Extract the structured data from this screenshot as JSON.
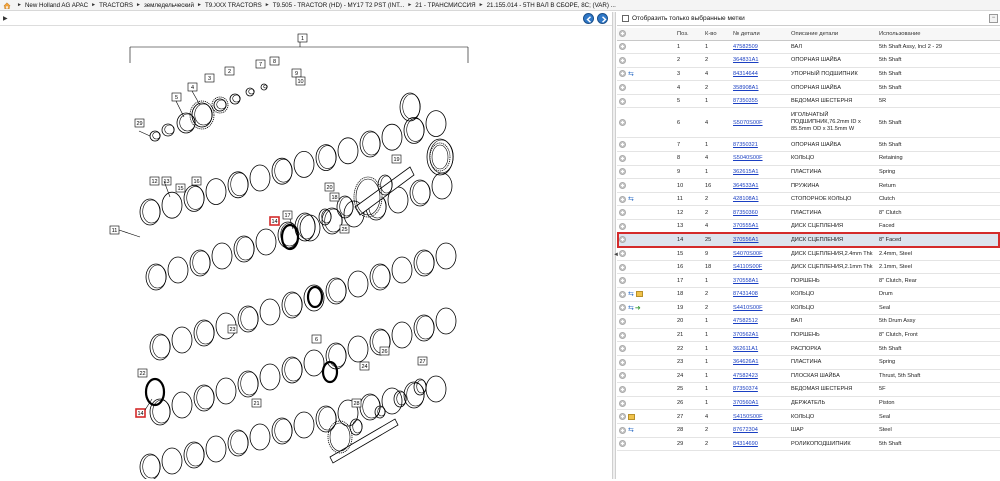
{
  "breadcrumb": [
    "New Holland AG APAC",
    "TRACTORS",
    "земледельческий",
    "T9.XXX TRACTORS",
    "T9.505 - TRACTOR (HD) - MY17 T2 PST (INT...",
    "21 - ТРАНСМИССИЯ",
    "21.155.014 - 5TH ВАЛ В СБОРЕ, 8C; (VAR) ..."
  ],
  "filter": {
    "label": "Отобразить только выбранные метки"
  },
  "table": {
    "columns": [
      "Поз.",
      "К-во",
      "№ детали",
      "Описание детали",
      "Использование"
    ],
    "rows": [
      {
        "pos": "1",
        "qty": "1",
        "part": "47582509",
        "desc": "ВАЛ",
        "use": "5th Shaft Assy, Incl 2 - 29",
        "icons": []
      },
      {
        "pos": "2",
        "qty": "2",
        "part": "364831A1",
        "desc": "ОПОРНАЯ ШАЙБА",
        "use": "5th Shaft",
        "icons": []
      },
      {
        "pos": "3",
        "qty": "4",
        "part": "84314644",
        "desc": "УПОРНЫЙ ПОДШИПНИК",
        "use": "5th Shaft",
        "icons": [
          "swap"
        ]
      },
      {
        "pos": "4",
        "qty": "2",
        "part": "358908A1",
        "desc": "ОПОРНАЯ ШАЙБА",
        "use": "5th Shaft",
        "icons": []
      },
      {
        "pos": "5",
        "qty": "1",
        "part": "87350355",
        "desc": "ВЕДОМАЯ ШЕСТЕРНЯ",
        "use": "5R",
        "icons": []
      },
      {
        "pos": "6",
        "qty": "4",
        "part": "S5070S00F",
        "desc": "ИГОЛЬЧАТЫЙ ПОДШИПНИК,76.2mm ID x 85.5mm OD x 31.5mm W",
        "use": "5th Shaft",
        "icons": [],
        "tall": true
      },
      {
        "pos": "7",
        "qty": "1",
        "part": "87350321",
        "desc": "ОПОРНАЯ ШАЙБА",
        "use": "5th Shaft",
        "icons": []
      },
      {
        "pos": "8",
        "qty": "4",
        "part": "S5040S00F",
        "desc": "КОЛЬЦО",
        "use": "Retaining",
        "icons": []
      },
      {
        "pos": "9",
        "qty": "1",
        "part": "362615A1",
        "desc": "ПЛАСТИНА",
        "use": "Spring",
        "icons": []
      },
      {
        "pos": "10",
        "qty": "16",
        "part": "364533A1",
        "desc": "ПРУЖИНА",
        "use": "Return",
        "icons": []
      },
      {
        "pos": "11",
        "qty": "2",
        "part": "428108A1",
        "desc": "СТОПОРНОЕ КОЛЬЦО",
        "use": "Clutch",
        "icons": [
          "swap"
        ]
      },
      {
        "pos": "12",
        "qty": "2",
        "part": "87350360",
        "desc": "ПЛАСТИНА",
        "use": "8\" Clutch",
        "icons": []
      },
      {
        "pos": "13",
        "qty": "4",
        "part": "370555A1",
        "desc": "ДИСК СЦЕПЛЕНИЯ",
        "use": "Faced",
        "icons": []
      },
      {
        "pos": "14",
        "qty": "25",
        "part": "370556A1",
        "desc": "ДИСК СЦЕПЛЕНИЯ",
        "use": "8\" Faced",
        "icons": [],
        "selected": true
      },
      {
        "pos": "15",
        "qty": "9",
        "part": "S4070S00F",
        "desc": "ДИСК СЦЕПЛЕНИЯ,2.4mm Thk",
        "use": "2.4mm, Steel",
        "icons": []
      },
      {
        "pos": "16",
        "qty": "18",
        "part": "S4110S00F",
        "desc": "ДИСК СЦЕПЛЕНИЯ,2.1mm Thk",
        "use": "2.1mm, Steel",
        "icons": []
      },
      {
        "pos": "17",
        "qty": "1",
        "part": "370558A1",
        "desc": "ПОРШЕНЬ",
        "use": "8\" Clutch, Rear",
        "icons": []
      },
      {
        "pos": "18",
        "qty": "2",
        "part": "87431408",
        "desc": "КОЛЬЦО",
        "use": "Drum",
        "icons": [
          "swap",
          "box"
        ]
      },
      {
        "pos": "19",
        "qty": "2",
        "part": "S4410S00F",
        "desc": "КОЛЬЦО",
        "use": "Seal",
        "icons": [
          "swap",
          "leaf"
        ]
      },
      {
        "pos": "20",
        "qty": "1",
        "part": "47582512",
        "desc": "ВАЛ",
        "use": "5th Drum Assy",
        "icons": []
      },
      {
        "pos": "21",
        "qty": "1",
        "part": "370562A1",
        "desc": "ПОРШЕНЬ",
        "use": "8\" Clutch, Front",
        "icons": []
      },
      {
        "pos": "22",
        "qty": "1",
        "part": "362611A1",
        "desc": "РАСПОРКА",
        "use": "5th Shaft",
        "icons": []
      },
      {
        "pos": "23",
        "qty": "1",
        "part": "364626A1",
        "desc": "ПЛАСТИНА",
        "use": "Spring",
        "icons": []
      },
      {
        "pos": "24",
        "qty": "1",
        "part": "47582423",
        "desc": "ПЛОСКАЯ ШАЙБА",
        "use": "Thrust, 5th Shaft",
        "icons": []
      },
      {
        "pos": "25",
        "qty": "1",
        "part": "87350374",
        "desc": "ВЕДОМАЯ ШЕСТЕРНЯ",
        "use": "5F",
        "icons": []
      },
      {
        "pos": "26",
        "qty": "1",
        "part": "370560A1",
        "desc": "ДЕРЖАТЕЛЬ",
        "use": "Piston",
        "icons": []
      },
      {
        "pos": "27",
        "qty": "4",
        "part": "S4150S00F",
        "desc": "КОЛЬЦО",
        "use": "Seal",
        "icons": [
          "box"
        ]
      },
      {
        "pos": "28",
        "qty": "2",
        "part": "87672304",
        "desc": "ШАР",
        "use": "Steel",
        "icons": [
          "swap"
        ]
      },
      {
        "pos": "29",
        "qty": "2",
        "part": "84314690",
        "desc": "РОЛИКОПОДШИПНИК",
        "use": "5th Shaft",
        "icons": []
      }
    ]
  },
  "diagram": {
    "callouts": [
      "1",
      "2",
      "3",
      "4",
      "5",
      "6",
      "7",
      "8",
      "9",
      "10",
      "11",
      "12",
      "13",
      "14",
      "15",
      "16",
      "17",
      "18",
      "19",
      "20",
      "21",
      "22",
      "23",
      "24",
      "25",
      "26",
      "27",
      "28",
      "29"
    ],
    "highlighted": "14"
  },
  "colors": {
    "link": "#1a3fc2",
    "highlight_border": "#d42b2b",
    "selected_row": "#dde4ee",
    "nav_button": "#2f78c8"
  }
}
